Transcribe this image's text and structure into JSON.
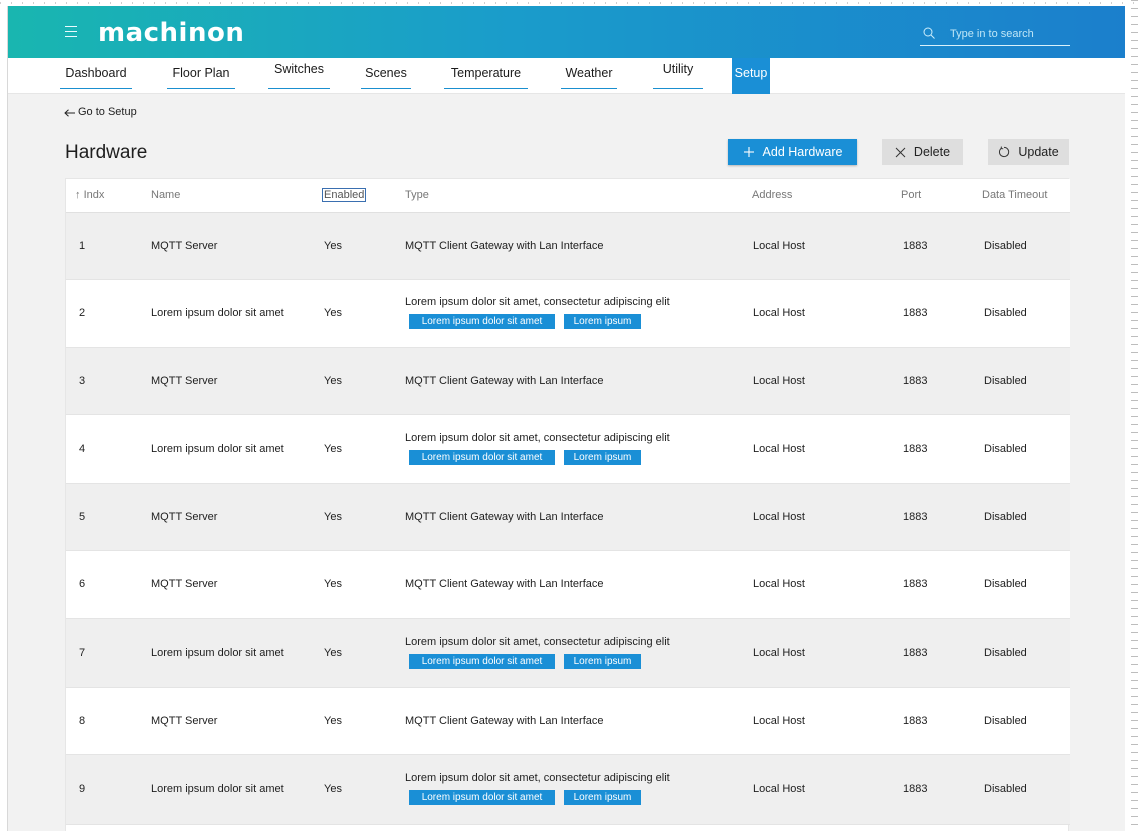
{
  "app": {
    "brand": "machinon",
    "search_placeholder": "Type in to search"
  },
  "nav": {
    "tabs": [
      {
        "label": "Dashboard"
      },
      {
        "label": "Floor Plan"
      },
      {
        "label": "Switches"
      },
      {
        "label": "Scenes"
      },
      {
        "label": "Temperature"
      },
      {
        "label": "Weather"
      },
      {
        "label": "Utility"
      },
      {
        "label": "Setup"
      }
    ],
    "active": "Setup"
  },
  "back_link": "Go to Setup",
  "page_title": "Hardware",
  "toolbar": {
    "add_label": "Add Hardware",
    "delete_label": "Delete",
    "update_label": "Update"
  },
  "colors": {
    "accent": "#1a8fd6",
    "header_gradient_start": "#19b6b0",
    "header_gradient_end": "#1b7fcc",
    "row_shade": "#efefef"
  },
  "table": {
    "columns": {
      "indx": "Indx",
      "name": "Name",
      "enabled": "Enabled",
      "type": "Type",
      "address": "Address",
      "port": "Port",
      "timeout": "Data Timeout"
    },
    "sort_column": "Indx",
    "rows": [
      {
        "indx": "1",
        "name": "MQTT Server",
        "enabled": "Yes",
        "type": "MQTT Client Gateway with Lan Interface",
        "tags": [],
        "address": "Local Host",
        "port": "1883",
        "timeout": "Disabled"
      },
      {
        "indx": "2",
        "name": "Lorem ipsum dolor sit amet",
        "enabled": "Yes",
        "type": "Lorem ipsum dolor sit amet, consectetur adipiscing elit",
        "tags": [
          "Lorem ipsum dolor sit amet",
          "Lorem ipsum"
        ],
        "address": "Local Host",
        "port": "1883",
        "timeout": "Disabled"
      },
      {
        "indx": "3",
        "name": "MQTT Server",
        "enabled": "Yes",
        "type": "MQTT Client Gateway with Lan Interface",
        "tags": [],
        "address": "Local Host",
        "port": "1883",
        "timeout": "Disabled"
      },
      {
        "indx": "4",
        "name": "Lorem ipsum dolor sit amet",
        "enabled": "Yes",
        "type": "Lorem ipsum dolor sit amet, consectetur adipiscing elit",
        "tags": [
          "Lorem ipsum dolor sit amet",
          "Lorem ipsum"
        ],
        "address": "Local Host",
        "port": "1883",
        "timeout": "Disabled"
      },
      {
        "indx": "5",
        "name": "MQTT Server",
        "enabled": "Yes",
        "type": "MQTT Client Gateway with Lan Interface",
        "tags": [],
        "address": "Local Host",
        "port": "1883",
        "timeout": "Disabled"
      },
      {
        "indx": "6",
        "name": "MQTT Server",
        "enabled": "Yes",
        "type": "MQTT Client Gateway with Lan Interface",
        "tags": [],
        "address": "Local Host",
        "port": "1883",
        "timeout": "Disabled"
      },
      {
        "indx": "7",
        "name": "Lorem ipsum dolor sit amet",
        "enabled": "Yes",
        "type": "Lorem ipsum dolor sit amet, consectetur adipiscing elit",
        "tags": [
          "Lorem ipsum dolor sit amet",
          "Lorem ipsum"
        ],
        "address": "Local Host",
        "port": "1883",
        "timeout": "Disabled"
      },
      {
        "indx": "8",
        "name": "MQTT Server",
        "enabled": "Yes",
        "type": "MQTT Client Gateway with Lan Interface",
        "tags": [],
        "address": "Local Host",
        "port": "1883",
        "timeout": "Disabled"
      },
      {
        "indx": "9",
        "name": "Lorem ipsum dolor sit amet",
        "enabled": "Yes",
        "type": "Lorem ipsum dolor sit amet, consectetur adipiscing elit",
        "tags": [
          "Lorem ipsum dolor sit amet",
          "Lorem ipsum"
        ],
        "address": "Local Host",
        "port": "1883",
        "timeout": "Disabled"
      }
    ]
  }
}
